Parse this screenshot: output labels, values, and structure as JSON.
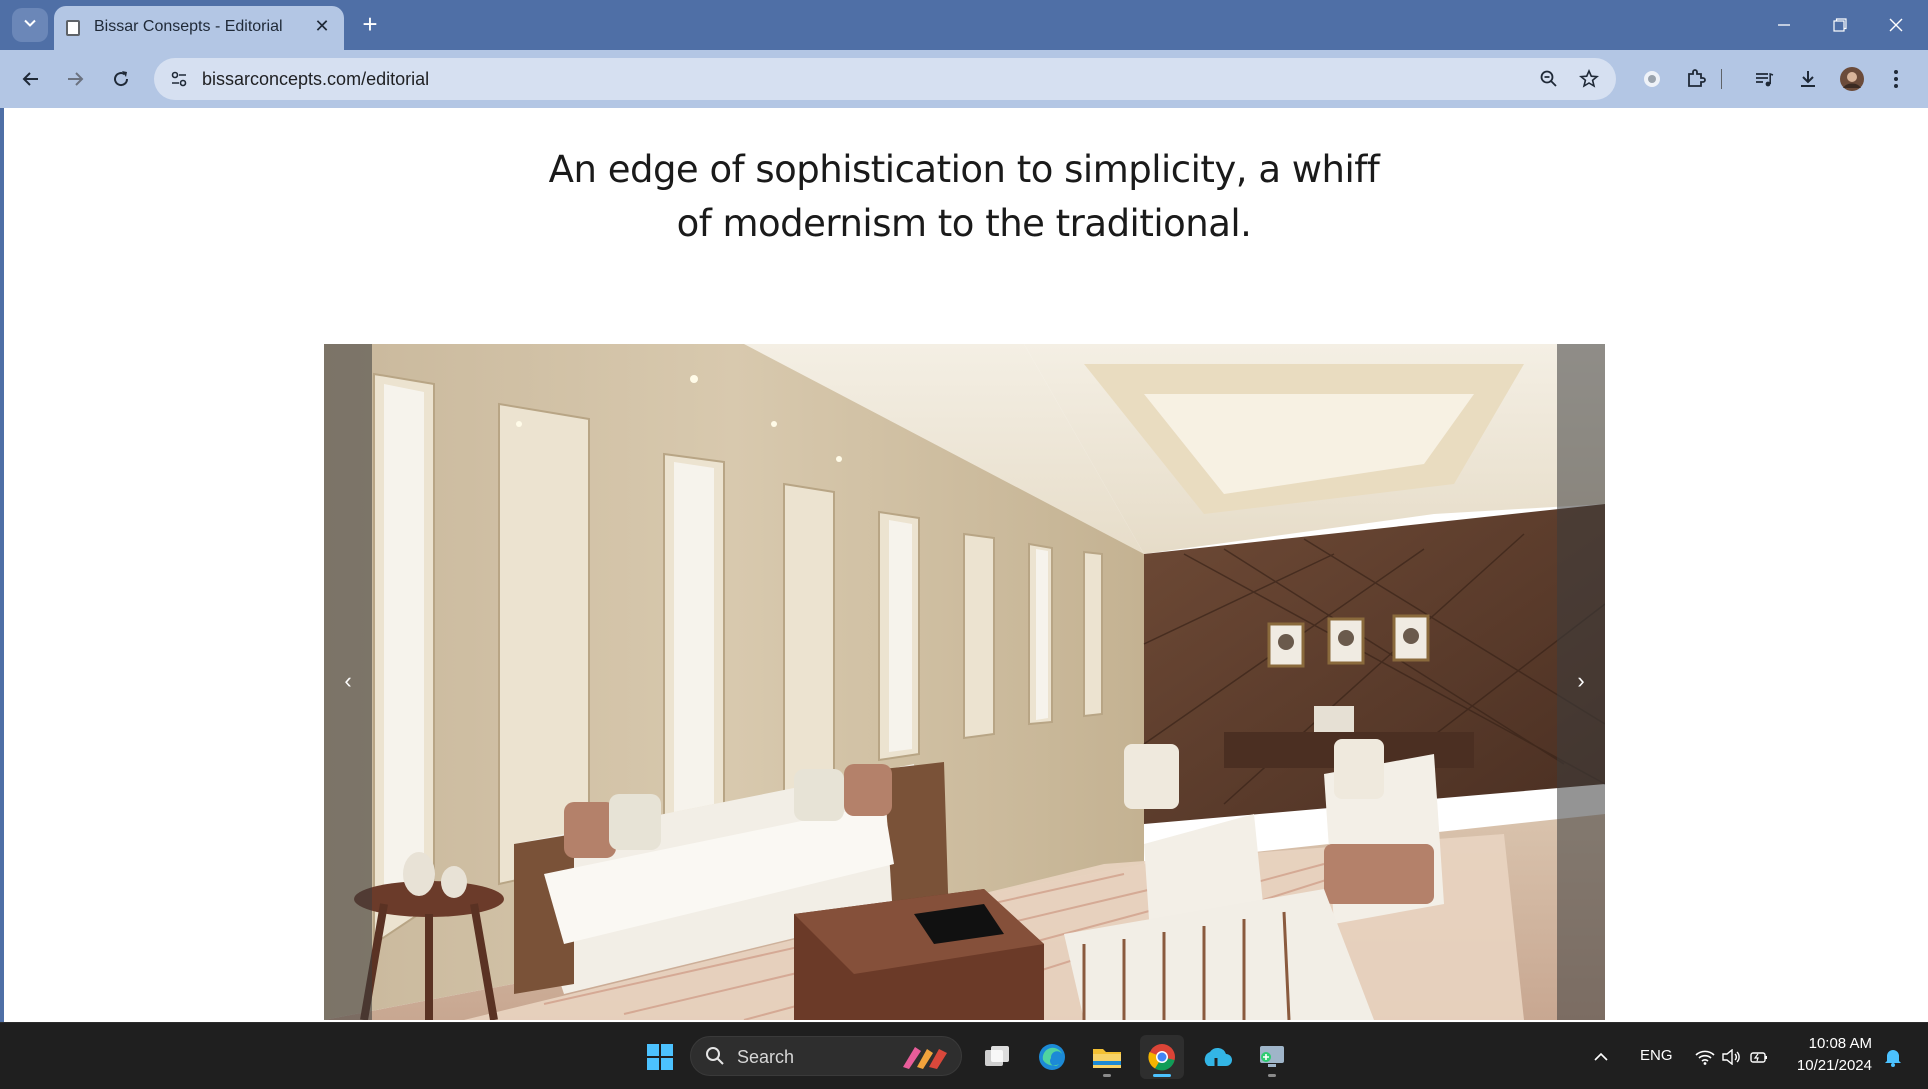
{
  "browser": {
    "tab_title": "Bissar Consepts - Editorial",
    "url": "bissarconcepts.com/editorial"
  },
  "page": {
    "headline_line1": "An edge of sophistication to simplicity, a whiff",
    "headline_line2": "of modernism to the traditional."
  },
  "taskbar": {
    "search_label": "Search",
    "language": "ENG",
    "time": "10:08 AM",
    "date": "10/21/2024"
  },
  "colors": {
    "tabbar": "#4f6fa6",
    "toolbar": "#b3c6e4",
    "taskbar": "#1f1f1f",
    "accent": "#4cc2ff"
  }
}
